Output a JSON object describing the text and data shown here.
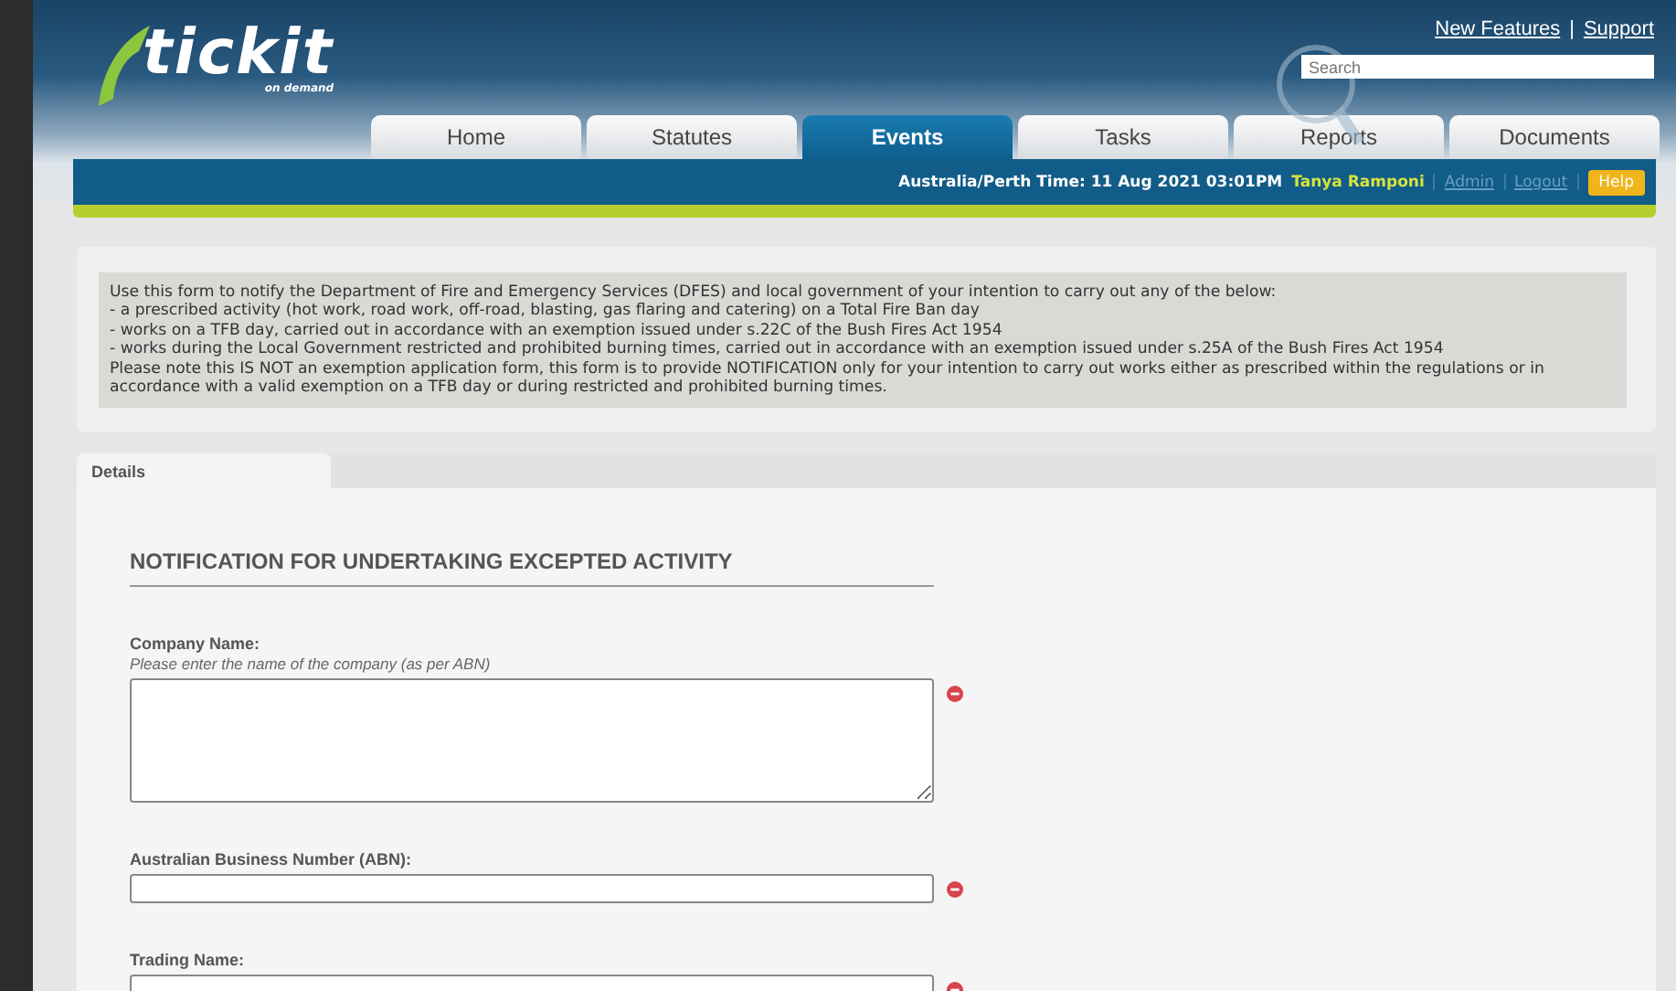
{
  "header": {
    "logo": {
      "text": "tickit",
      "subtext": "on demand"
    },
    "links": [
      "New Features",
      "Support"
    ],
    "link_separator": "|",
    "search": {
      "placeholder": "Search"
    }
  },
  "tabs": [
    {
      "label": "Home",
      "selected": false
    },
    {
      "label": "Statutes",
      "selected": false
    },
    {
      "label": "Events",
      "selected": true
    },
    {
      "label": "Tasks",
      "selected": false
    },
    {
      "label": "Reports",
      "selected": false
    },
    {
      "label": "Documents",
      "selected": false
    }
  ],
  "status_bar": {
    "time": "Australia/Perth Time: 11 Aug 2021 03:01PM",
    "user": "Tanya Ramponi",
    "links": [
      "Admin",
      "Logout"
    ],
    "help": "Help"
  },
  "notice": {
    "lines": [
      "Use this form to notify the Department of Fire and Emergency Services (DFES) and local government of your intention to carry out any of the below:",
      "- a prescribed activity (hot work, road work, off-road, blasting, gas flaring and catering) on a Total Fire Ban day",
      "- works on a TFB day, carried out in accordance with an exemption issued under s.22C of the Bush Fires Act 1954",
      "- works during the Local Government restricted and prohibited burning times, carried out in accordance with an exemption issued under s.25A of the Bush Fires Act 1954",
      "Please note this IS NOT an exemption application form, this form is to provide NOTIFICATION only for your intention to carry out works either as prescribed within the regulations or in accordance with a valid exemption on a TFB day or during restricted and prohibited burning times."
    ]
  },
  "form": {
    "tabs": [
      {
        "label": "Details",
        "selected": true
      }
    ],
    "heading": "NOTIFICATION FOR UNDERTAKING EXCEPTED ACTIVITY",
    "fields": [
      {
        "kind": "textarea",
        "label": "Company Name:",
        "hint": "Please enter the name of the company (as per ABN)",
        "required": true
      },
      {
        "kind": "text",
        "label": "Australian Business Number (ABN):",
        "required": true
      },
      {
        "kind": "text",
        "label": "Trading Name:",
        "required": true
      }
    ]
  }
}
